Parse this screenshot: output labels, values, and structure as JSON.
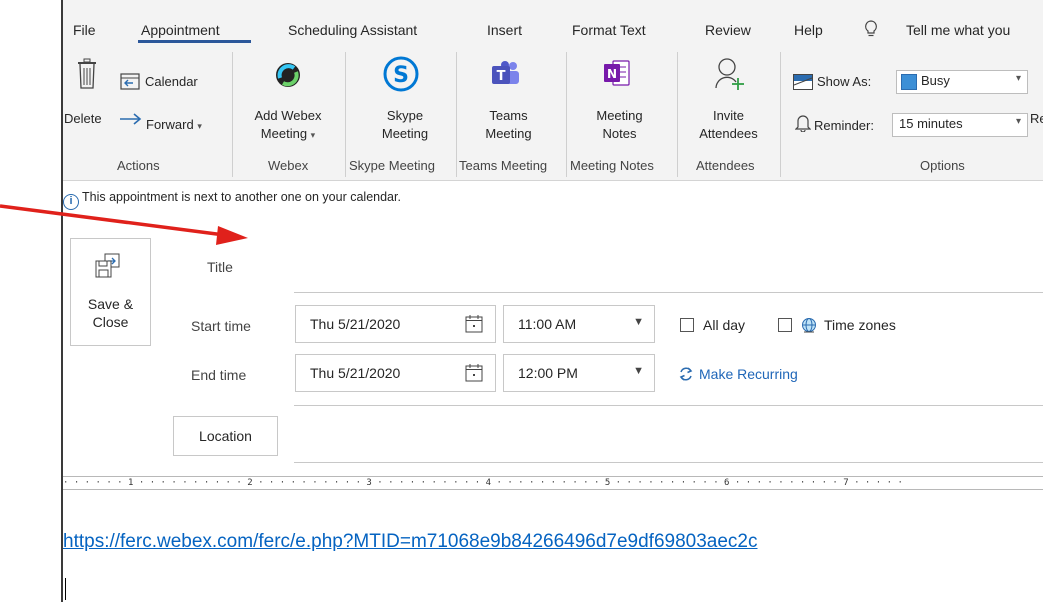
{
  "tabs": [
    {
      "label": "File",
      "active": false
    },
    {
      "label": "Appointment",
      "active": true
    },
    {
      "label": "Scheduling Assistant",
      "active": false
    },
    {
      "label": "Insert",
      "active": false
    },
    {
      "label": "Format Text",
      "active": false
    },
    {
      "label": "Review",
      "active": false
    },
    {
      "label": "Help",
      "active": false
    }
  ],
  "tell_me": "Tell me what you",
  "ribbon": {
    "actions": {
      "delete": "Delete",
      "calendar": "Calendar",
      "forward": "Forward",
      "group": "Actions"
    },
    "webex": {
      "line1": "Add Webex",
      "line2": "Meeting",
      "group": "Webex"
    },
    "skype": {
      "line1": "Skype",
      "line2": "Meeting",
      "group": "Skype Meeting"
    },
    "teams": {
      "line1": "Teams",
      "line2": "Meeting",
      "group": "Teams Meeting"
    },
    "notes": {
      "line1": "Meeting",
      "line2": "Notes",
      "group": "Meeting Notes"
    },
    "attendees": {
      "line1": "Invite",
      "line2": "Attendees",
      "group": "Attendees"
    },
    "options": {
      "show_as_label": "Show As:",
      "show_as_value": "Busy",
      "reminder_label": "Reminder:",
      "reminder_value": "15 minutes",
      "cutoff": "Re",
      "group": "Options"
    }
  },
  "info_message": "This appointment is next to another one on your calendar.",
  "form": {
    "save_line1": "Save &",
    "save_line2": "Close",
    "title_label": "Title",
    "title_value": "",
    "start_label": "Start time",
    "start_date": "Thu 5/21/2020",
    "start_time": "11:00 AM",
    "end_label": "End time",
    "end_date": "Thu 5/21/2020",
    "end_time": "12:00 PM",
    "all_day": "All day",
    "all_day_checked": false,
    "time_zones": "Time zones",
    "time_zones_checked": false,
    "make_recurring": "Make Recurring",
    "location_label": "Location",
    "location_value": ""
  },
  "ruler_text": "· · · · · · 1 · · · · · · · · · · 2 · · · · · · · · · · 3 · · · · · · · · · · 4 · · · · · · · · · · 5 · · · · · · · · · · 6 · · · · · · · · · · 7 · · · · ·",
  "body_link": "https://ferc.webex.com/ferc/e.php?MTID=m71068e9b84266496d7e9df69803aec2c",
  "colors": {
    "accent": "#2b579a",
    "link": "#0563c1",
    "annotation": "#e0211b"
  }
}
